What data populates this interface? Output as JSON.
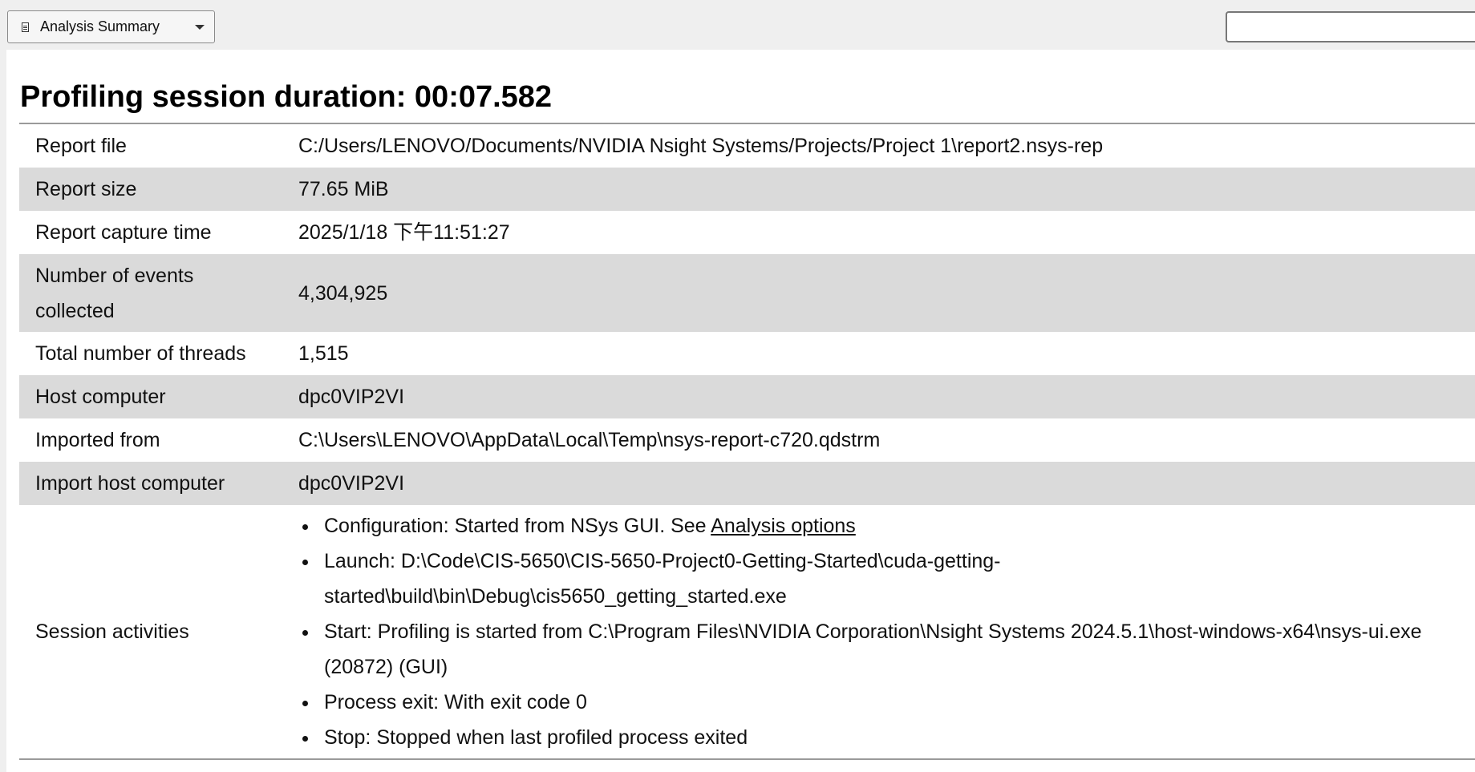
{
  "toolbar": {
    "view_selector": {
      "label": "Analysis Summary",
      "icon": "document-icon"
    },
    "search": {
      "value": "",
      "placeholder": ""
    }
  },
  "summary": {
    "title": "Profiling session duration: 00:07.582",
    "rows": [
      {
        "key": "Report file",
        "value": "C:/Users/LENOVO/Documents/NVIDIA Nsight Systems/Projects/Project 1\\report2.nsys-rep"
      },
      {
        "key": "Report size",
        "value": "77.65 MiB"
      },
      {
        "key": "Report capture time",
        "value": "2025/1/18 下午11:51:27"
      },
      {
        "key": "Number of events collected",
        "value": "4,304,925"
      },
      {
        "key": "Total number of threads",
        "value": "1,515"
      },
      {
        "key": "Host computer",
        "value": "dpc0VIP2VI"
      },
      {
        "key": "Imported from",
        "value": "C:\\Users\\LENOVO\\AppData\\Local\\Temp\\nsys-report-c720.qdstrm"
      },
      {
        "key": "Import host computer",
        "value": "dpc0VIP2VI"
      }
    ],
    "session_activities": {
      "key": "Session activities",
      "configuration_prefix": "Configuration: Started from NSys GUI. See ",
      "configuration_link": "Analysis options",
      "launch": "Launch: D:\\Code\\CIS-5650\\CIS-5650-Project0-Getting-Started\\cuda-getting-started\\build\\bin\\Debug\\cis5650_getting_started.exe",
      "start": "Start: Profiling is started from C:\\Program Files\\NVIDIA Corporation\\Nsight Systems 2024.5.1\\host-windows-x64\\nsys-ui.exe (20872) (GUI)",
      "process_exit": "Process exit: With exit code 0",
      "stop": "Stop: Stopped when last profiled process exited"
    }
  }
}
